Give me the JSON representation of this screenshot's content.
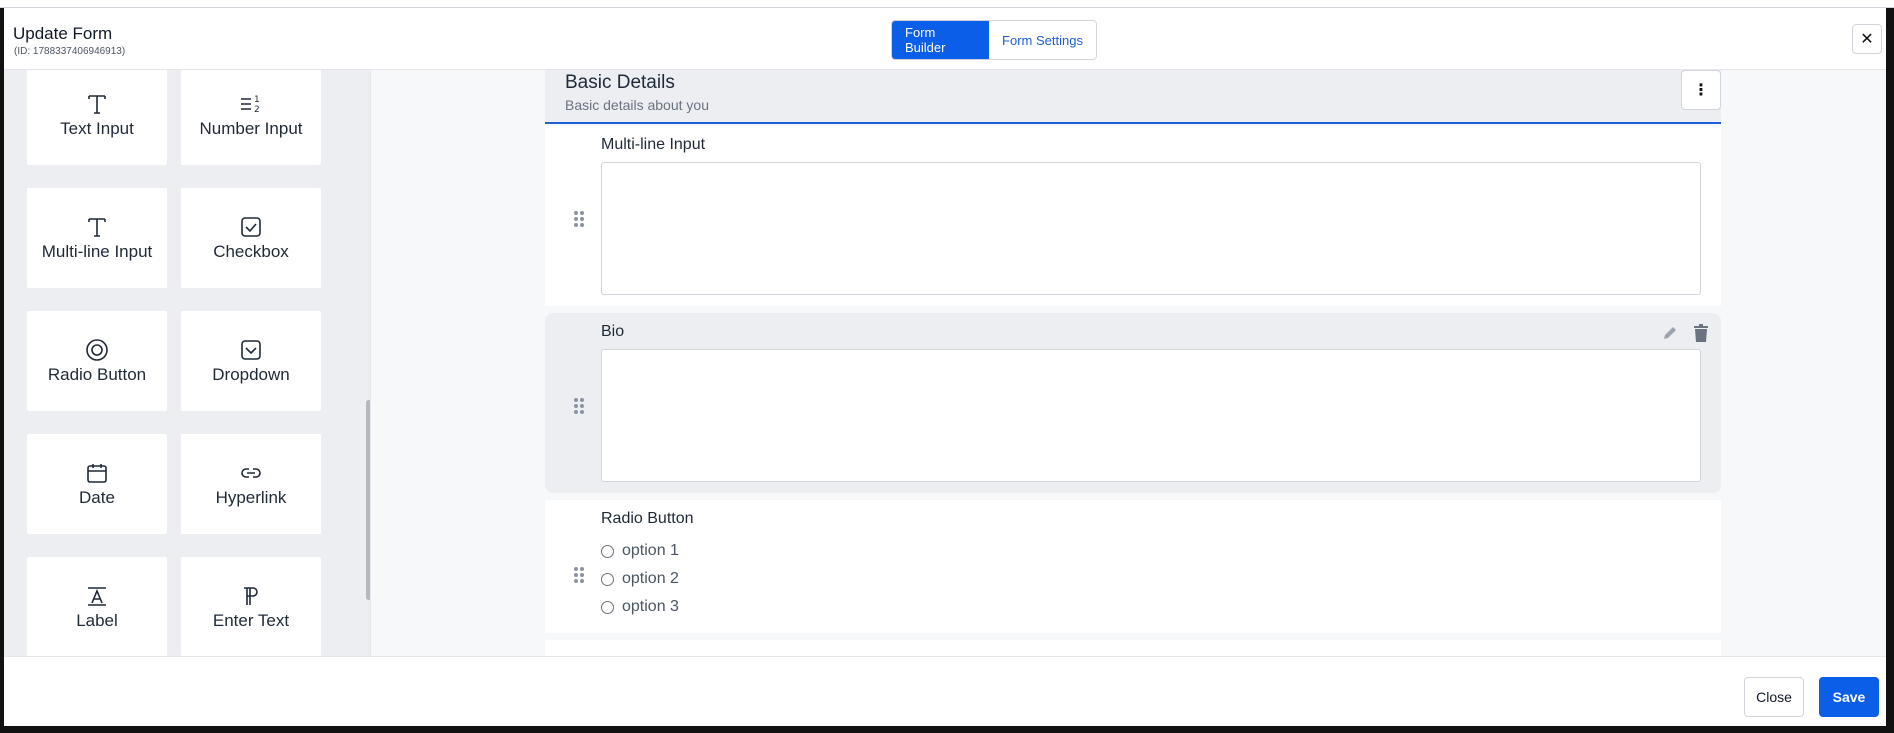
{
  "header": {
    "title": "Update Form",
    "id_text": "(ID: 1788337406946913)",
    "tabs": [
      {
        "label": "Form Builder",
        "active": true
      },
      {
        "label": "Form Settings",
        "active": false
      }
    ],
    "close_icon": "close-icon"
  },
  "sidebar": {
    "tiles": [
      {
        "label": "Text Input",
        "icon": "text-icon"
      },
      {
        "label": "Number Input",
        "icon": "number-list-icon"
      },
      {
        "label": "Multi-line Input",
        "icon": "text-icon"
      },
      {
        "label": "Checkbox",
        "icon": "checkbox-icon"
      },
      {
        "label": "Radio Button",
        "icon": "radio-icon"
      },
      {
        "label": "Dropdown",
        "icon": "dropdown-icon"
      },
      {
        "label": "Date",
        "icon": "calendar-icon"
      },
      {
        "label": "Hyperlink",
        "icon": "link-icon"
      },
      {
        "label": "Label",
        "icon": "label-icon"
      },
      {
        "label": "Enter Text",
        "icon": "paragraph-icon"
      }
    ]
  },
  "section": {
    "title": "Basic Details",
    "description": "Basic details about you"
  },
  "fields": [
    {
      "label": "Multi-line Input",
      "type": "textarea"
    },
    {
      "label": "Bio",
      "type": "textarea"
    },
    {
      "label": "Radio Button",
      "type": "radio",
      "options": [
        "option 1",
        "option 2",
        "option 3"
      ]
    }
  ],
  "footer": {
    "close_label": "Close",
    "save_label": "Save"
  },
  "colors": {
    "primary": "#0b5ee8",
    "section_underline": "#1d5fd6",
    "sidebar_bg": "#eceef2"
  }
}
